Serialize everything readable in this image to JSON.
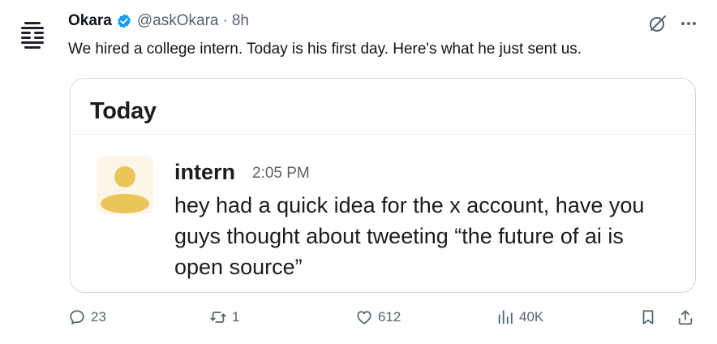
{
  "colors": {
    "accent": "#1d9bf0",
    "text": "#0f1419",
    "muted": "#536471",
    "card_border": "#cfd9de",
    "avatar_yellow": "#ecc55a"
  },
  "tweet": {
    "author_name": "Okara",
    "handle": "@askOkara",
    "separator": "·",
    "time": "8h",
    "text": "We hired a college intern. Today is his first day. Here's what he just sent us."
  },
  "card": {
    "title": "Today",
    "message": {
      "author": "intern",
      "time": "2:05 PM",
      "text": "hey had a quick idea for the x account, have you guys thought about tweeting “the future of ai is open source”"
    }
  },
  "actions": {
    "replies": "23",
    "reposts": "1",
    "likes": "612",
    "views": "40K"
  },
  "icons": [
    "okara-logo-icon",
    "verified-badge-icon",
    "grok-icon",
    "more-icon",
    "reply-icon",
    "repost-icon",
    "like-icon",
    "views-icon",
    "bookmark-icon",
    "share-icon"
  ]
}
